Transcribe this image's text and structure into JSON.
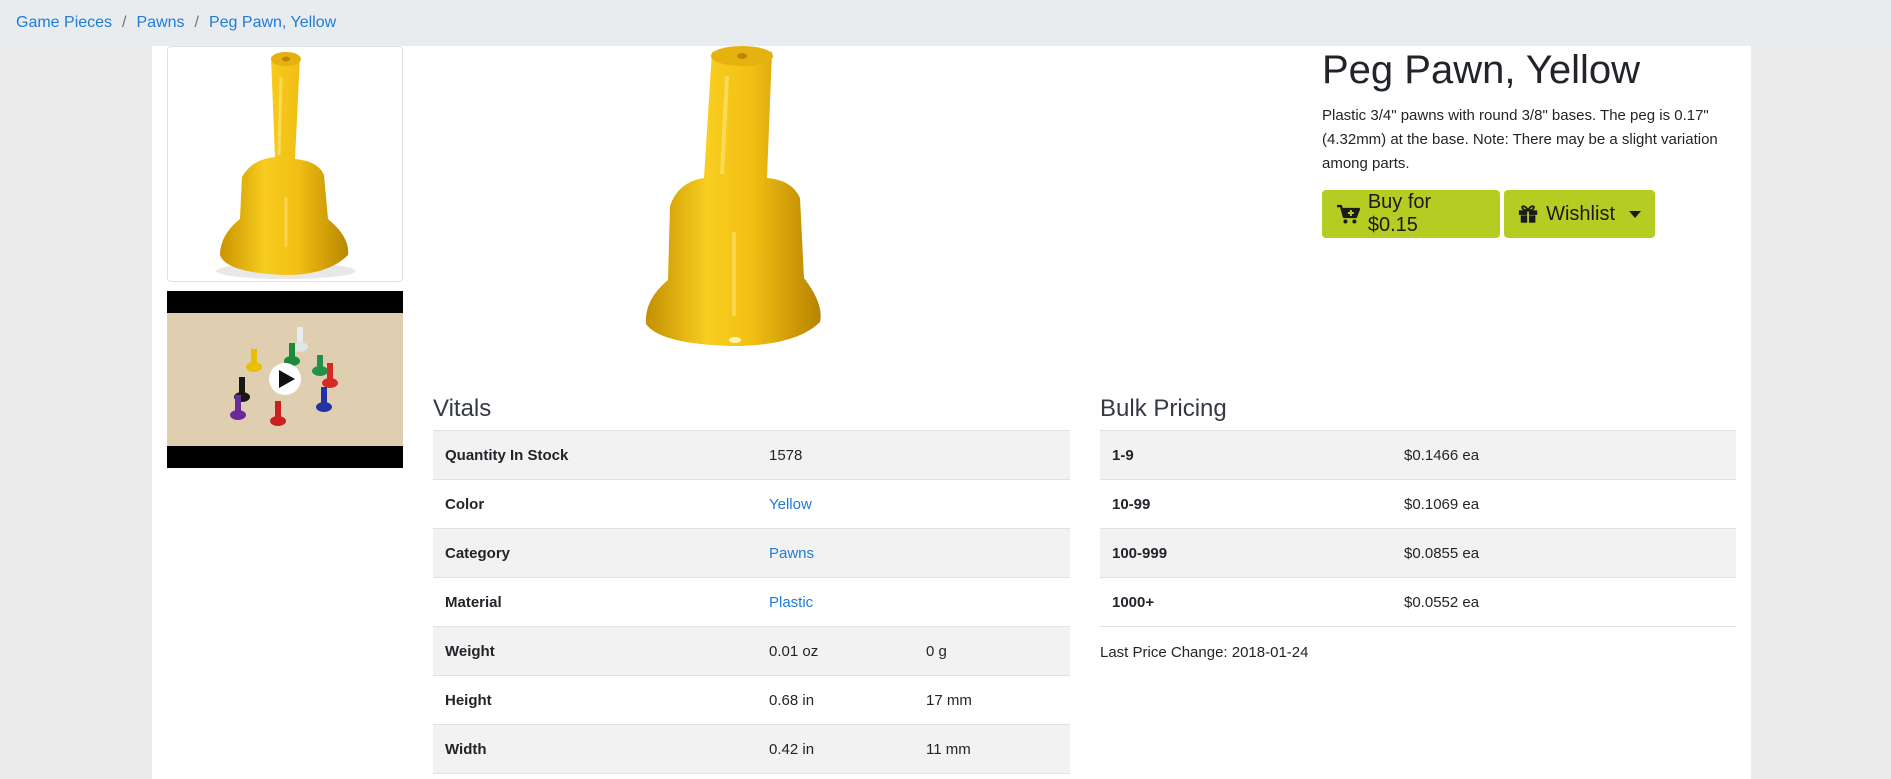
{
  "breadcrumb": [
    "Game Pieces",
    "Pawns",
    "Peg Pawn, Yellow"
  ],
  "product": {
    "title": "Peg Pawn, Yellow",
    "description": "Plastic 3/4\" pawns with round 3/8\" bases. The peg is 0.17\" (4.32mm) at the base. Note: There may be a slight variation among parts.",
    "buy_label": "Buy for $0.15",
    "wishlist_label": "Wishlist"
  },
  "vitals": {
    "title": "Vitals",
    "rows": [
      {
        "label": "Quantity In Stock",
        "value": "1578",
        "extra": ""
      },
      {
        "label": "Color",
        "value": "Yellow",
        "extra": ""
      },
      {
        "label": "Category",
        "value": "Pawns",
        "extra": ""
      },
      {
        "label": "Material",
        "value": "Plastic",
        "extra": ""
      },
      {
        "label": "Weight",
        "value": "0.01 oz",
        "extra": "0 g"
      },
      {
        "label": "Height",
        "value": "0.68 in",
        "extra": "17 mm"
      },
      {
        "label": "Width",
        "value": "0.42 in",
        "extra": "11 mm"
      }
    ]
  },
  "bulk_pricing": {
    "title": "Bulk Pricing",
    "rows": [
      {
        "range": "1-9",
        "price": "$0.1466 ea"
      },
      {
        "range": "10-99",
        "price": "$0.1069 ea"
      },
      {
        "range": "100-999",
        "price": "$0.0855 ea"
      },
      {
        "range": "1000+",
        "price": "$0.0552 ea"
      }
    ],
    "last_price_change": "Last Price Change: 2018-01-24"
  },
  "colors": {
    "accent_button": "#b5cc22",
    "link": "#1e7cd6",
    "pawn_yellow": "#f2c014"
  }
}
